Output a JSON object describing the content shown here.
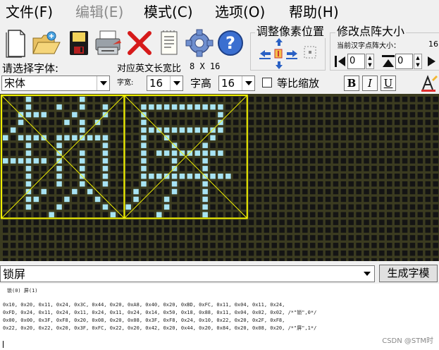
{
  "menu": [
    "文件(F)",
    "编辑(E)",
    "模式(C)",
    "选项(O)",
    "帮助(H)"
  ],
  "toolbar": {
    "icons": [
      "new-file-icon",
      "open-folder-icon",
      "save-disk-icon",
      "print-icon",
      "delete-icon",
      "notepad-icon",
      "settings-gear-icon",
      "help-icon"
    ]
  },
  "adjust_group": {
    "title": "调整像素位置"
  },
  "dot_size_group": {
    "title": "修改点阵大小",
    "current_label": "当前汉字点阵大小：",
    "current_value": "16",
    "width_value": "0",
    "height_value": "0"
  },
  "font": {
    "select_label": "请选择字体:",
    "value": "宋体",
    "ratio_label": "对应英文长宽比",
    "ratio_value": "8 X 16",
    "width_label": "字宽:",
    "width_value": "16",
    "height_label": "字高",
    "height_value": "16",
    "scale_label": "等比缩放",
    "scale_checked": false,
    "bold": "B",
    "italic": "I",
    "underline": "U"
  },
  "colors": {
    "grid_bg": "#3b3b20",
    "cell": "#141414",
    "lit": "#a8e4f4",
    "frame": "#f0f000"
  },
  "input_text": "锁屏",
  "generate_button": "生成字模",
  "output": {
    "header": "锁(0) 屏(1)",
    "lines": [
      "0x10, 0x20, 0x11, 0x24, 0x3C, 0x44, 0x20, 0xA8, 0x40, 0x20, 0xBD, 0xFC, 0x11, 0x04, 0x11, 0x24,",
      "0xFD, 0x24, 0x11, 0x24, 0x11, 0x24, 0x11, 0x24, 0x14, 0x50, 0x18, 0x88, 0x11, 0x04, 0x02, 0x02, /*\"锁\",0*/",
      "0x00, 0x00, 0x3F, 0xF8, 0x20, 0x08, 0x20, 0x08, 0x3F, 0xF8, 0x24, 0x10, 0x22, 0x20, 0x2F, 0xF8,",
      "0x22, 0x20, 0x22, 0x20, 0x3F, 0xFC, 0x22, 0x20, 0x42, 0x20, 0x44, 0x20, 0x84, 0x20, 0x08, 0x20, /*\"屏\",1*/"
    ]
  },
  "watermark": "CSDN @STM时"
}
